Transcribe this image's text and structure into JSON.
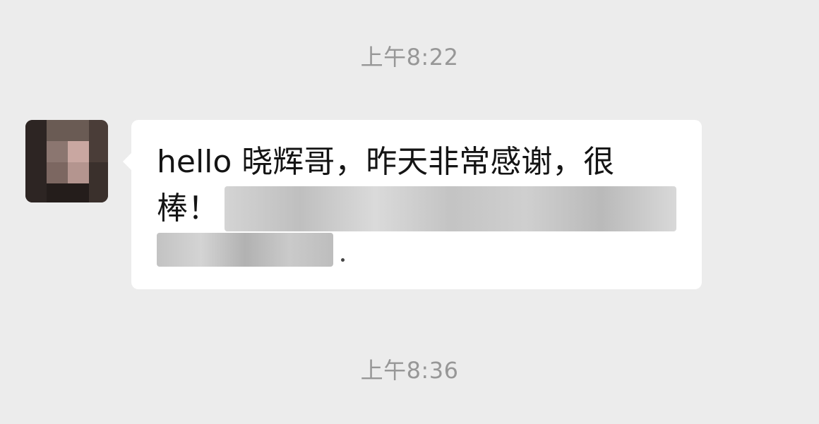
{
  "chat": {
    "timestamps": [
      "上午8:22",
      "上午8:36"
    ],
    "message": {
      "line1": "hello 晓辉哥，昨天非常感谢，很",
      "line2_visible": "棒！"
    }
  },
  "icons": {
    "avatar": "avatar-icon"
  },
  "colors": {
    "background": "#ececec",
    "bubble": "#ffffff",
    "timestamp": "#979797",
    "text": "#141414"
  }
}
